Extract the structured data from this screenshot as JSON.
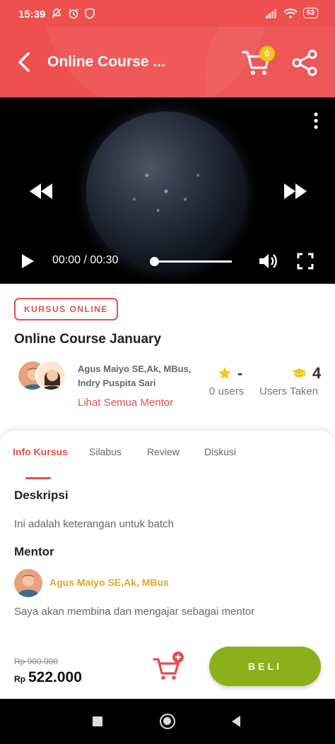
{
  "status_bar": {
    "time": "15:39",
    "battery": "53"
  },
  "header": {
    "title": "Online Course ...",
    "cart_count": "0"
  },
  "video": {
    "time": "00:00 / 00:30"
  },
  "course": {
    "tag": "KURSUS ONLINE",
    "title": "Online Course January",
    "mentors_line1": "Agus Maiyo SE,Ak, MBus,",
    "mentors_line2": "Indry Puspita Sari",
    "see_all_mentors": "Lihat Semua Mentor",
    "rating_value": "-",
    "rating_label": "0 users",
    "taken_value": "4",
    "taken_label": "Users Taken"
  },
  "tabs": [
    {
      "label": "Info Kursus",
      "active": true
    },
    {
      "label": "Silabus",
      "active": false
    },
    {
      "label": "Review",
      "active": false
    },
    {
      "label": "Diskusi",
      "active": false
    }
  ],
  "info": {
    "description_heading": "Deskripsi",
    "description_text": "Ini adalah keterangan untuk batch",
    "mentor_heading": "Mentor",
    "mentor_name": "Agus Maiyo SE,Ak, MBus",
    "mentor_bio": "Saya akan membina dan mengajar sebagai mentor"
  },
  "buy": {
    "old_price": "Rp 900.000",
    "currency": "Rp",
    "price": "522.000",
    "button_label": "BELI"
  },
  "colors": {
    "primary": "#ee4f4f",
    "buy_button": "#8bb01a",
    "badge": "#f5c518",
    "mentor_name": "#e6a520"
  }
}
